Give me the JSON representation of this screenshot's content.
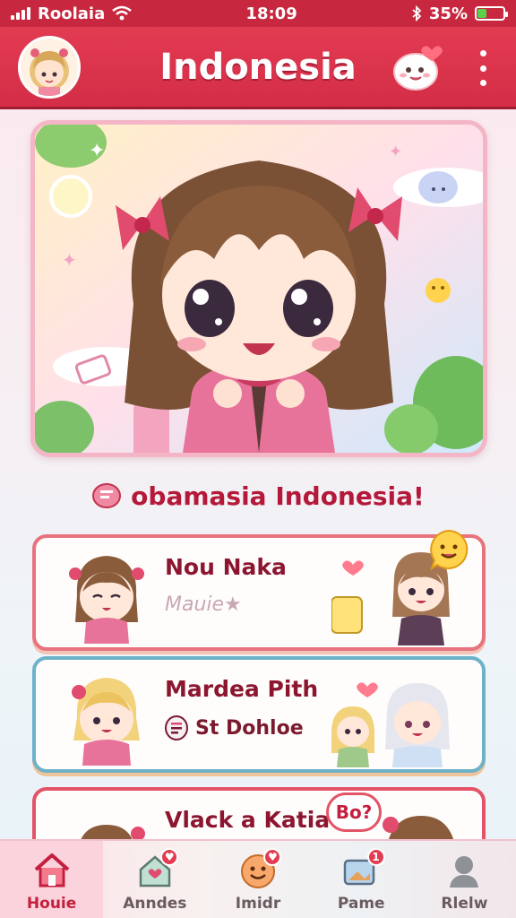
{
  "status_bar": {
    "carrier": "Roolaia",
    "time": "18:09",
    "battery": "35%",
    "battery_level": 0.35
  },
  "header": {
    "title": "Indonesia",
    "avatar": "profile-avatar",
    "mascot": "mascot-heart-icon",
    "menu_icon": "more-vertical-icon"
  },
  "welcome": {
    "text": "obamasia Indonesia!"
  },
  "cards": [
    {
      "name": "Nou Naka",
      "subtitle": "Mauie★"
    },
    {
      "name": "Mardea Pith",
      "subtitle": "St Dohloe"
    },
    {
      "name": "Vlack a Katia",
      "bubble": "Bo?"
    }
  ],
  "nav": [
    {
      "label": "Houie",
      "icon": "home-icon",
      "active": true
    },
    {
      "label": "Anndes",
      "icon": "house-heart-icon",
      "active": false
    },
    {
      "label": "Imidr",
      "icon": "smile-face-icon",
      "active": false
    },
    {
      "label": "Pame",
      "icon": "picture-badge-icon",
      "active": false
    },
    {
      "label": "Rlelw",
      "icon": "person-icon",
      "active": false
    }
  ],
  "colors": {
    "primary": "#d42d47",
    "accent": "#b5193a",
    "card_border_1": "#e6737d",
    "card_border_2": "#6cb2c9"
  }
}
